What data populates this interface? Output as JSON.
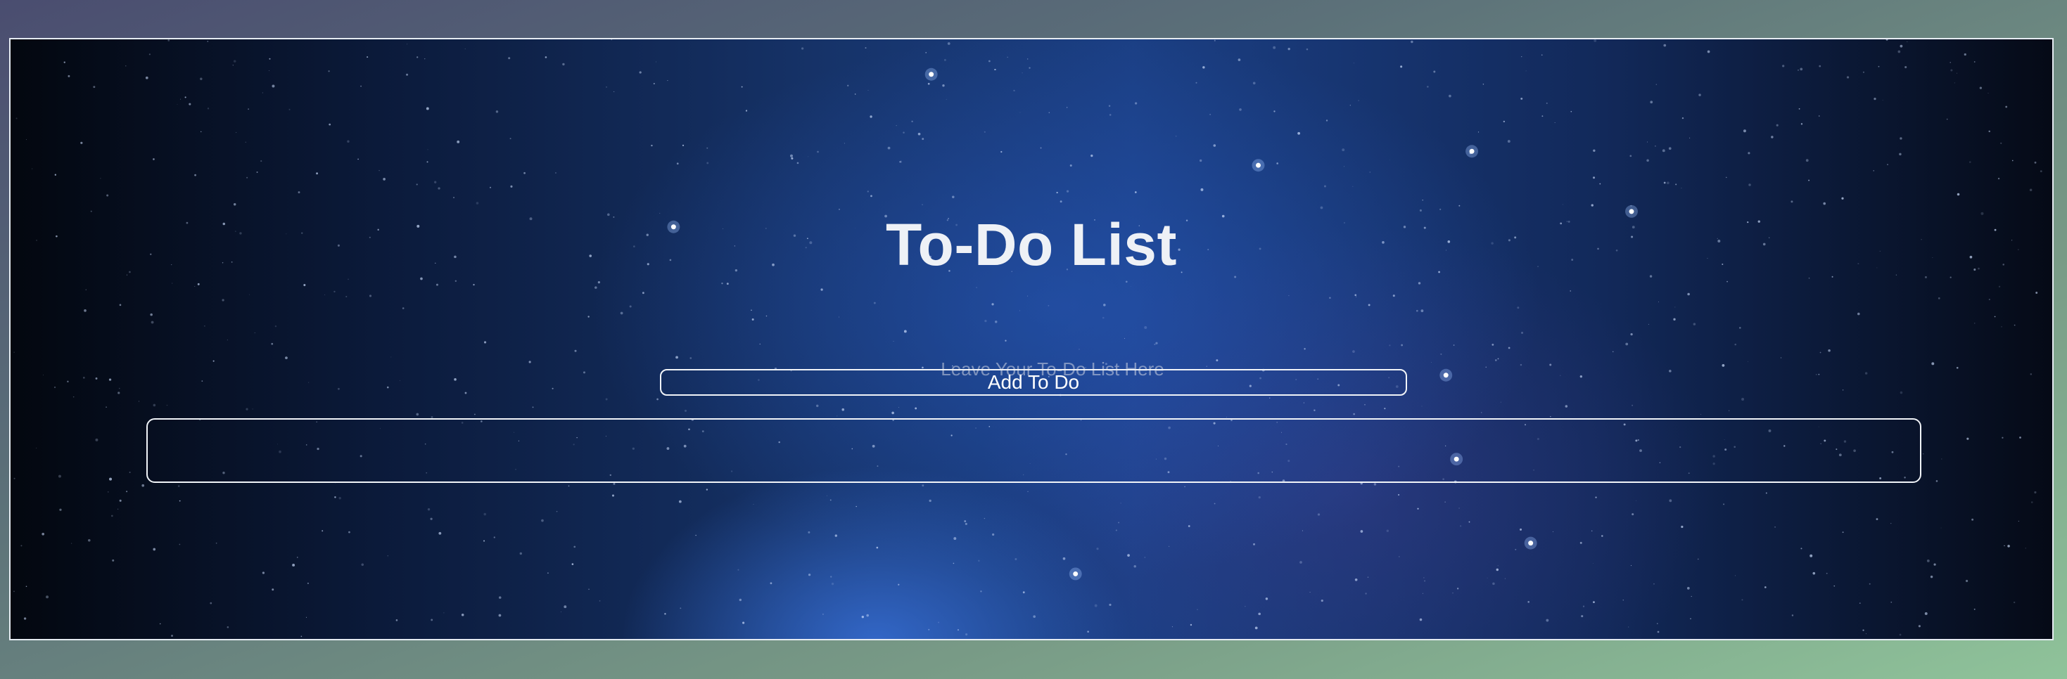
{
  "app": {
    "title": "To-Do List"
  },
  "todo_input": {
    "value": "",
    "placeholder": "Leave Your To-Do List Here"
  },
  "add_button": {
    "label": "Add To Do"
  },
  "todo_list": {
    "items": []
  },
  "theme": {
    "background": "starry-night-sky",
    "text_color": "#ffffff",
    "border_color": "#f1f4f8"
  }
}
